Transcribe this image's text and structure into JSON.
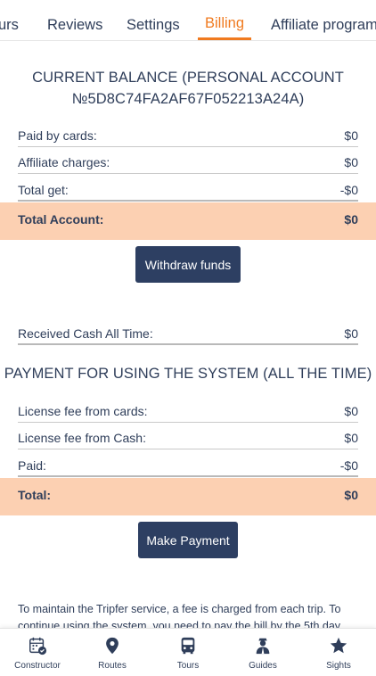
{
  "tabs": [
    {
      "label": "urs"
    },
    {
      "label": "Reviews"
    },
    {
      "label": "Settings"
    },
    {
      "label": "Billing",
      "active": true
    },
    {
      "label": "Affiliate program"
    }
  ],
  "balance": {
    "title_line1": "CURRENT BALANCE (PERSONAL ACCOUNT",
    "title_line2": "№5D8C74FA2AF67F052213A24A)",
    "rows": [
      {
        "label": "Paid by cards:",
        "value": "$0"
      },
      {
        "label": "Affiliate charges:",
        "value": "$0"
      },
      {
        "label": "Total get:",
        "value": "-$0"
      }
    ],
    "total": {
      "label": "Total Account:",
      "value": "$0"
    },
    "withdraw_button": "Withdraw funds",
    "received": {
      "label": "Received Cash All Time:",
      "value": "$0"
    }
  },
  "payment": {
    "title": "PAYMENT FOR USING THE SYSTEM (ALL THE TIME)",
    "rows": [
      {
        "label": "License fee from cards:",
        "value": "$0"
      },
      {
        "label": "License fee from Cash:",
        "value": "$0"
      },
      {
        "label": "Paid:",
        "value": "-$0"
      }
    ],
    "total": {
      "label": "Total:",
      "value": "$0"
    },
    "pay_button": "Make Payment"
  },
  "note": "To maintain the Tripfer service, a fee is charged from each trip. To continue using the system, you need to pay the bill by the 5th day",
  "bottom_nav": [
    {
      "label": "Constructor",
      "icon": "calendar-check-icon"
    },
    {
      "label": "Routes",
      "icon": "map-pin-icon"
    },
    {
      "label": "Tours",
      "icon": "bus-icon"
    },
    {
      "label": "Guides",
      "icon": "guide-icon"
    },
    {
      "label": "Sights",
      "icon": "star-icon"
    }
  ],
  "colors": {
    "accent": "#f07a1f",
    "text": "#2f3e5a",
    "button": "#2d3f62",
    "highlight": "#fcd0b2"
  }
}
